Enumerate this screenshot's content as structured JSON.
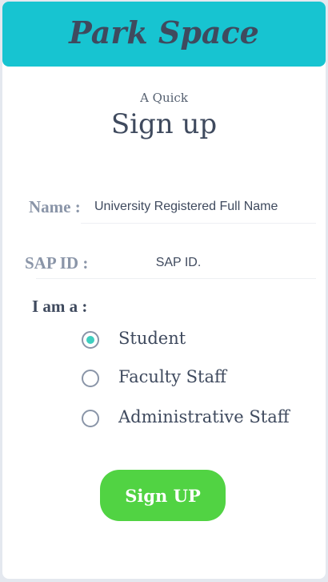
{
  "header": {
    "brand": "Park Space",
    "color": "#17c4d1"
  },
  "intro": {
    "subtitle": "A Quick",
    "title": "Sign up"
  },
  "form": {
    "name_label": "Name :",
    "name_placeholder": "University Registered Full Name",
    "sap_label": "SAP ID :",
    "sap_placeholder": "SAP ID.",
    "role_label": "I am a :",
    "roles": [
      {
        "label": "Student",
        "selected": true
      },
      {
        "label": "Faculty Staff",
        "selected": false
      },
      {
        "label": "Administrative Staff",
        "selected": false
      }
    ],
    "submit_label": "Sign UP",
    "submit_color": "#51d343"
  }
}
